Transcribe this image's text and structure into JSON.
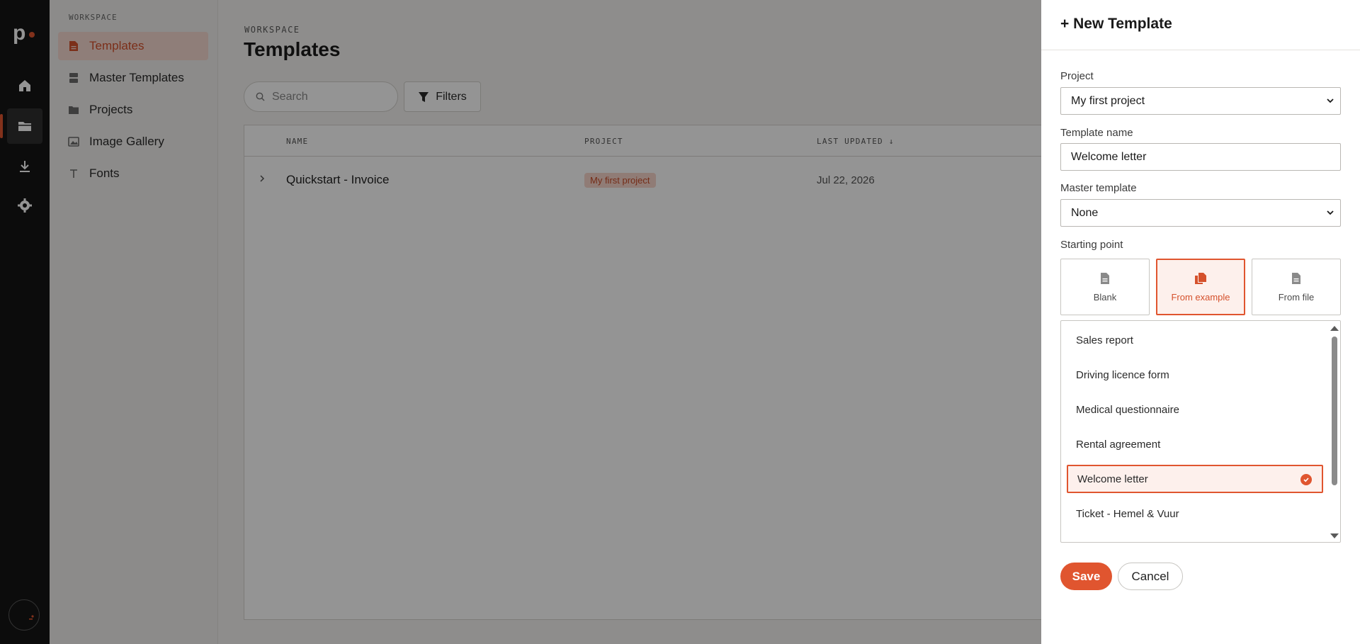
{
  "rail": {
    "logo": "p",
    "items": [
      {
        "icon": "home-icon"
      },
      {
        "icon": "folder-icon",
        "active": true
      },
      {
        "icon": "download-icon"
      },
      {
        "icon": "gear-icon"
      }
    ]
  },
  "sidebar": {
    "section": "WORKSPACE",
    "items": [
      {
        "label": "Templates",
        "icon": "document-icon",
        "active": true
      },
      {
        "label": "Master Templates",
        "icon": "stack-icon"
      },
      {
        "label": "Projects",
        "icon": "folder-icon"
      },
      {
        "label": "Image Gallery",
        "icon": "image-icon"
      },
      {
        "label": "Fonts",
        "icon": "text-icon"
      }
    ]
  },
  "main": {
    "eyebrow": "WORKSPACE",
    "title": "Templates",
    "search_placeholder": "Search",
    "filters_label": "Filters",
    "columns": {
      "name": "NAME",
      "project": "PROJECT",
      "updated": "LAST UPDATED ↓"
    },
    "rows": [
      {
        "name": "Quickstart - Invoice",
        "project": "My first project",
        "updated": "Jul 22, 2026"
      }
    ]
  },
  "drawer": {
    "title": "+ New Template",
    "project_label": "Project",
    "project_value": "My first project",
    "name_label": "Template name",
    "name_value": "Welcome letter",
    "master_label": "Master template",
    "master_value": "None",
    "starting_label": "Starting point",
    "starting_options": [
      {
        "label": "Blank"
      },
      {
        "label": "From example",
        "selected": true
      },
      {
        "label": "From file"
      }
    ],
    "examples": [
      "Sales report",
      "Driving licence form",
      "Medical questionnaire",
      "Rental agreement",
      "Welcome letter",
      "Ticket - Hemel & Vuur"
    ],
    "selected_example": "Welcome letter",
    "save_label": "Save",
    "cancel_label": "Cancel"
  },
  "colors": {
    "accent": "#e0552f",
    "rail": "#161616",
    "badge_bg": "#f9d6cb"
  }
}
